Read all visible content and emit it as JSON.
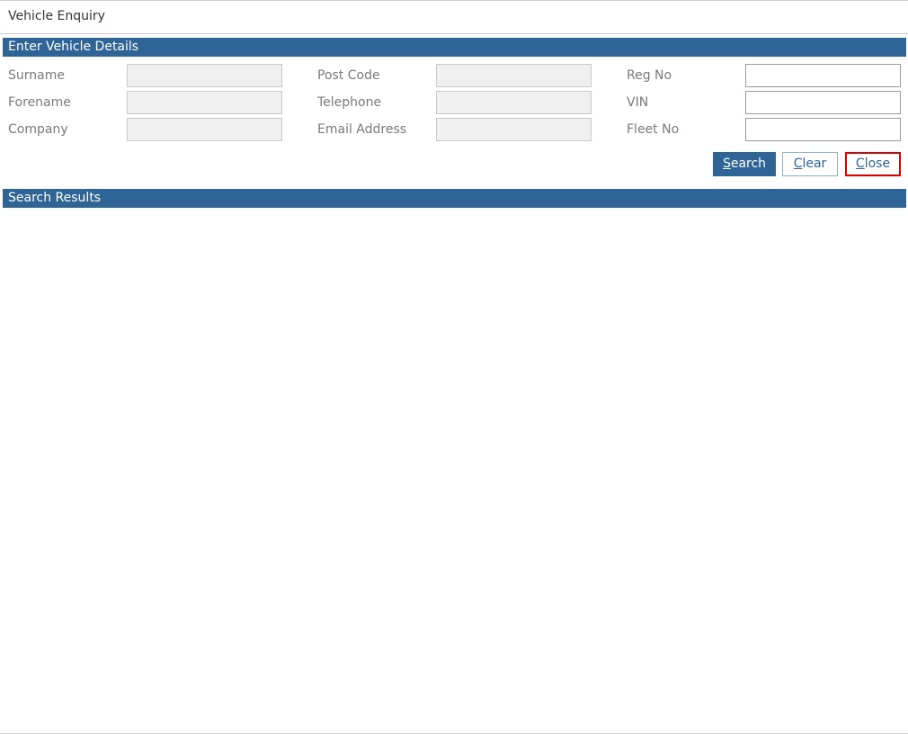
{
  "window": {
    "title": "Vehicle Enquiry"
  },
  "details_section": {
    "header": "Enter Vehicle Details",
    "fields": {
      "surname": {
        "label": "Surname",
        "value": ""
      },
      "forename": {
        "label": "Forename",
        "value": ""
      },
      "company": {
        "label": "Company",
        "value": ""
      },
      "post_code": {
        "label": "Post Code",
        "value": ""
      },
      "telephone": {
        "label": "Telephone",
        "value": ""
      },
      "email_address": {
        "label": "Email Address",
        "value": ""
      },
      "reg_no": {
        "label": "Reg No",
        "value": ""
      },
      "vin": {
        "label": "VIN",
        "value": ""
      },
      "fleet_no": {
        "label": "Fleet No",
        "value": ""
      }
    }
  },
  "actions": {
    "search": {
      "accesskey": "S",
      "rest": "earch"
    },
    "clear": {
      "accesskey": "C",
      "rest": "lear"
    },
    "close": {
      "accesskey": "C",
      "rest": "lose"
    }
  },
  "results_section": {
    "header": "Search Results"
  },
  "colors": {
    "header_bg": "#2f6496",
    "highlight_border": "#d90000"
  }
}
